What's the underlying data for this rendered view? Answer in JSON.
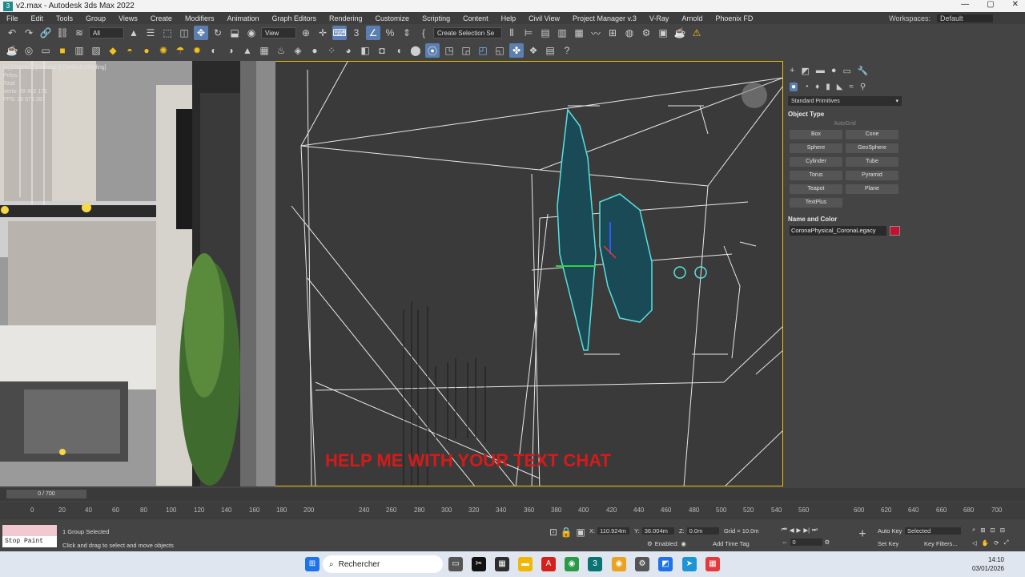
{
  "window": {
    "title": "v2.max - Autodesk 3ds Max 2022",
    "controls": [
      "—",
      "▢",
      "✕"
    ]
  },
  "menubar": {
    "items": [
      "File",
      "Edit",
      "Tools",
      "Group",
      "Views",
      "Create",
      "Modifiers",
      "Animation",
      "Graph Editors",
      "Rendering",
      "Customize",
      "Scripting",
      "Content",
      "Help",
      "Civil View",
      "Project Manager v.3",
      "V-Ray",
      "Arnold",
      "Phoenix FD"
    ],
    "workspace_label": "Workspaces:",
    "workspace_value": "Default"
  },
  "toolbar": {
    "selection_filter": "All",
    "ref_coord": "View",
    "selection_set": "Create Selection Se"
  },
  "viewport_left": {
    "label_lines": [
      "[+] [Camera] [Standard] [Default Shading]",
      "Polys:",
      "Total",
      "Verts: 28 482 171",
      "FPS: 10 673 397"
    ]
  },
  "viewport_main": {
    "overlay_text": "HELP ME WITH YOUR TEXT CHAT"
  },
  "command_panel": {
    "category": "Standard Primitives",
    "object_type_title": "Object Type",
    "autogrid_label": "AutoGrid",
    "primitives": [
      "Box",
      "Cone",
      "Sphere",
      "GeoSphere",
      "Cylinder",
      "Tube",
      "Torus",
      "Pyramid",
      "Teapot",
      "Plane",
      "TextPlus"
    ],
    "name_color_title": "Name and Color",
    "object_name": "CoronaPhysical_CoronaLegacy",
    "object_color": "#c8102e"
  },
  "timeline": {
    "slider_label": "0 / 700",
    "ticks": [
      "0",
      "20",
      "40",
      "60",
      "80",
      "100",
      "120",
      "140",
      "160",
      "180",
      "200",
      "240",
      "260",
      "280",
      "300",
      "320",
      "340",
      "360",
      "380",
      "400",
      "420",
      "440",
      "460",
      "480",
      "500",
      "520",
      "540",
      "560",
      "600",
      "620",
      "640",
      "660",
      "680",
      "700"
    ]
  },
  "status": {
    "selection": "1 Group Selected",
    "prompt": "Click and drag to select and move objects",
    "script_label": "Stop Paint",
    "x_label": "X:",
    "x_value": "110.924m",
    "y_label": "Y:",
    "y_value": "36.004m",
    "z_label": "Z:",
    "z_value": "0.0m",
    "grid": "Grid = 10.0m",
    "enabled_label": "Enabled:",
    "add_time_tag": "Add Time Tag",
    "auto_key": "Auto Key",
    "selected_value": "Selected",
    "set_key": "Set Key",
    "key_filters": "Key Filters...",
    "frame_value": "0"
  },
  "taskbar": {
    "search_placeholder": "Rechercher",
    "time": "14:10",
    "date": "03/01/2026"
  }
}
